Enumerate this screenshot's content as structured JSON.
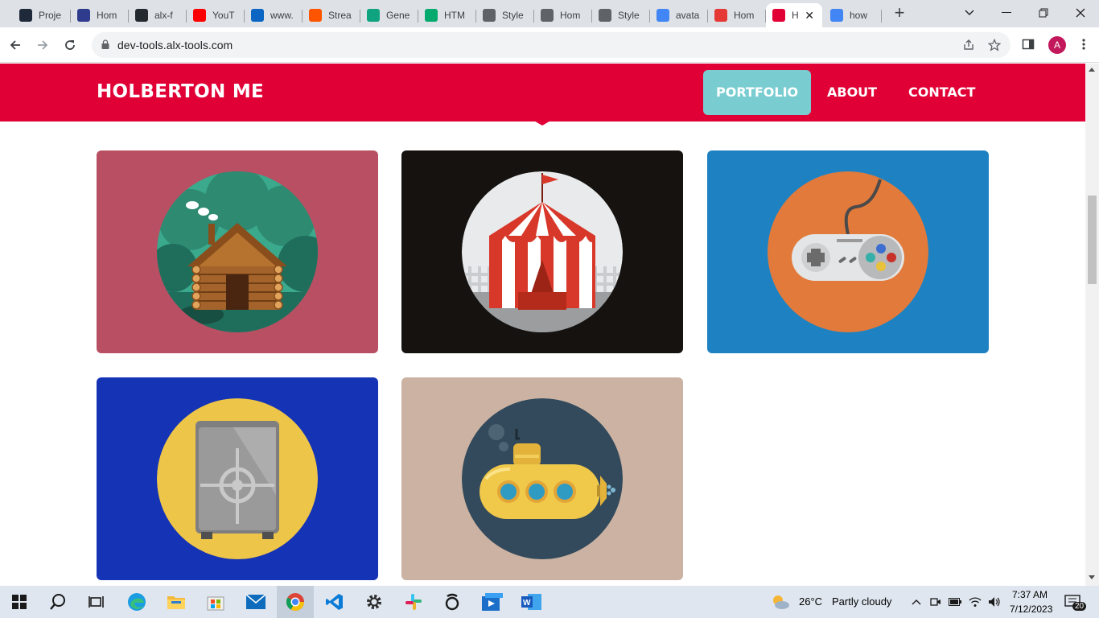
{
  "browser": {
    "tabs": [
      {
        "label": "Proje",
        "icon": "alx-icon",
        "color": "#1e2a3a"
      },
      {
        "label": "Hom",
        "icon": "grid-icon",
        "color": "#2f3b8c"
      },
      {
        "label": "alx-f",
        "icon": "github-icon",
        "color": "#24292f"
      },
      {
        "label": "YouT",
        "icon": "youtube-icon",
        "color": "#ff0000"
      },
      {
        "label": "www.",
        "icon": "linkedin-icon",
        "color": "#0a66c2"
      },
      {
        "label": "Strea",
        "icon": "soundcloud-icon",
        "color": "#ff5500"
      },
      {
        "label": "Gene",
        "icon": "openai-icon",
        "color": "#10a37f"
      },
      {
        "label": "HTM",
        "icon": "w3-icon",
        "color": "#04aa6d"
      },
      {
        "label": "Style",
        "icon": "globe-icon",
        "color": "#5f6368"
      },
      {
        "label": "Hom",
        "icon": "globe-icon",
        "color": "#5f6368"
      },
      {
        "label": "Style",
        "icon": "globe-icon",
        "color": "#5f6368"
      },
      {
        "label": "avata",
        "icon": "google-icon",
        "color": "#4285f4"
      },
      {
        "label": "Hom",
        "icon": "t-icon",
        "color": "#e53935"
      },
      {
        "label": "H",
        "icon": "holberton-icon",
        "color": "#e10036"
      },
      {
        "label": "how",
        "icon": "google-icon",
        "color": "#4285f4"
      }
    ],
    "url": "dev-tools.alx-tools.com",
    "profile_initial": "A"
  },
  "site": {
    "brand": "HOLBERTON ME",
    "nav": [
      {
        "label": "PORTFOLIO",
        "active": true
      },
      {
        "label": "ABOUT",
        "active": false
      },
      {
        "label": "CONTACT",
        "active": false
      }
    ],
    "accent": "#e10036",
    "active_nav_color": "#79cdd1",
    "portfolio": [
      {
        "name": "log-cabin",
        "background": "#b84f63",
        "circle": "#3aa98c"
      },
      {
        "name": "circus-tent",
        "background": "#151210",
        "circle": "#e8eaeb"
      },
      {
        "name": "game-controller",
        "background": "#1e82c2",
        "circle": "#e27a3b"
      },
      {
        "name": "safe",
        "background": "#1533b5",
        "circle": "#edc548"
      },
      {
        "name": "submarine",
        "background": "#cbb2a2",
        "circle": "#324a5b"
      }
    ]
  },
  "taskbar": {
    "weather_temp": "26°C",
    "weather_text": "Partly cloudy",
    "time": "7:37 AM",
    "date": "7/12/2023",
    "notifications": "20"
  }
}
